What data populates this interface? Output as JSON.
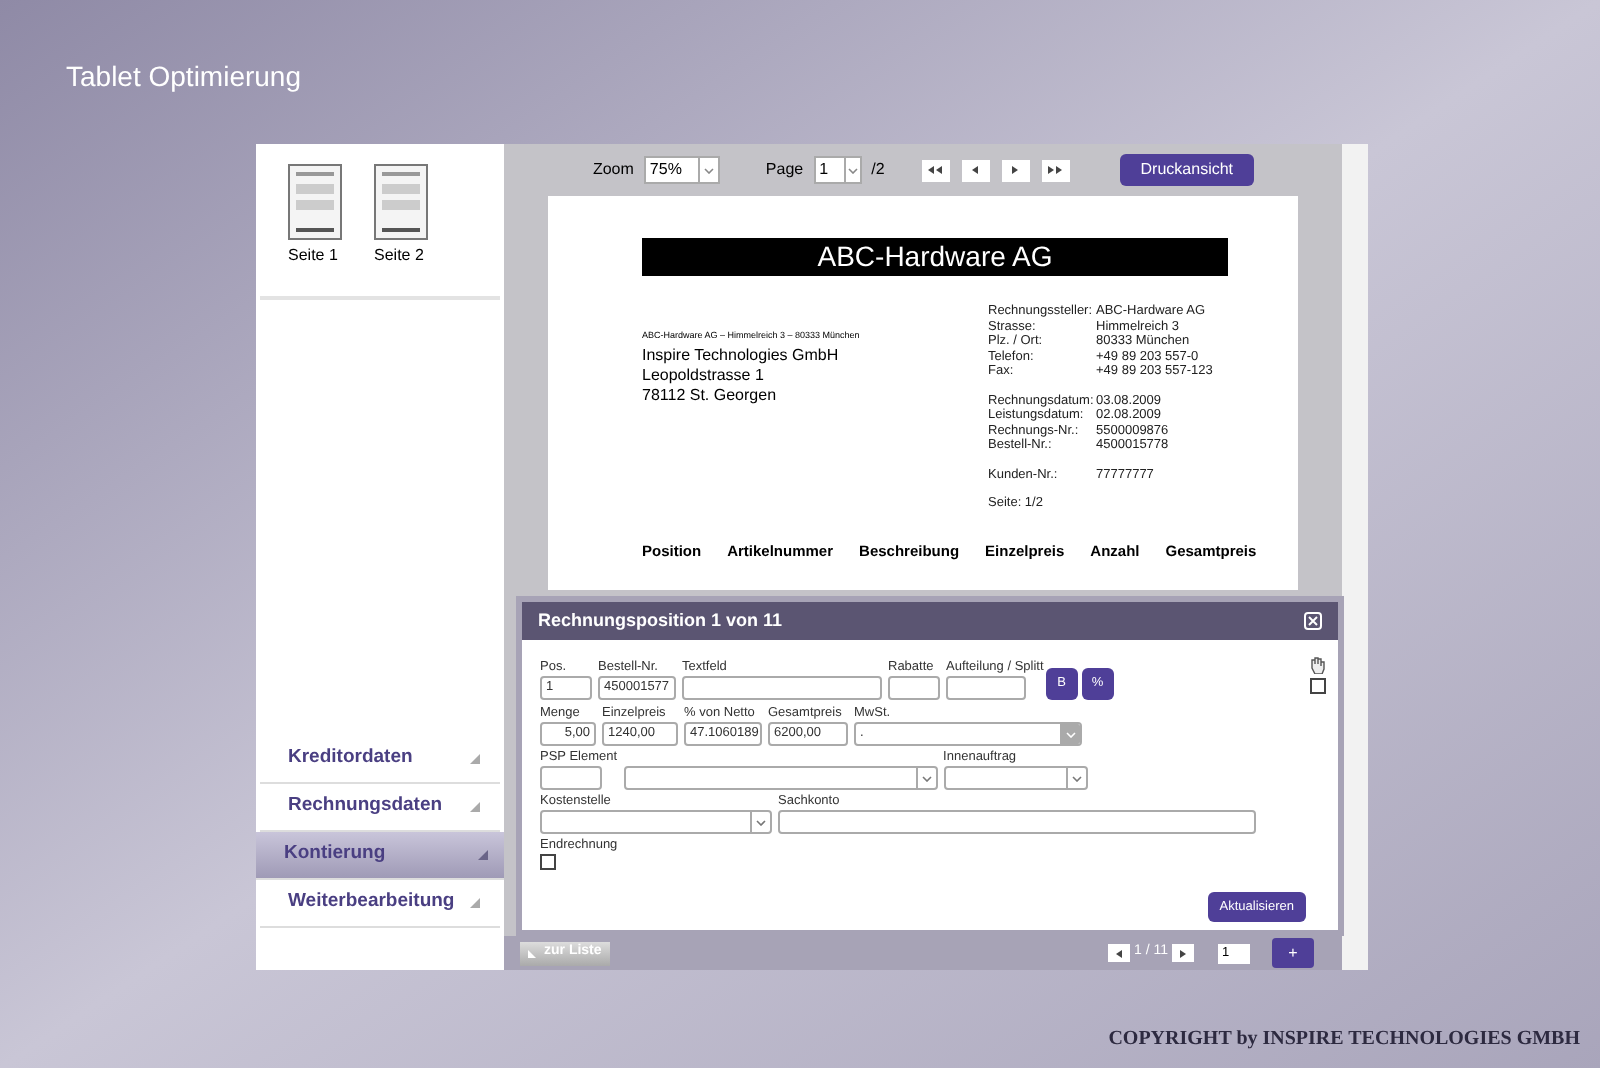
{
  "slide_title": "Tablet Optimierung",
  "thumbnails": [
    {
      "label": "Seite 1",
      "selected": false
    },
    {
      "label": "Seite 2",
      "selected": false
    }
  ],
  "nav": [
    {
      "label": "Kreditordaten",
      "selected": false
    },
    {
      "label": "Rechnungsdaten",
      "selected": false
    },
    {
      "label": "Kontierung",
      "selected": true
    },
    {
      "label": "Weiterbearbeitung",
      "selected": false
    }
  ],
  "toolbar": {
    "zoom_label": "Zoom",
    "zoom_value": "75%",
    "page_label": "Page",
    "page_value": "1",
    "page_total": "/2",
    "print_button": "Druckansicht"
  },
  "document": {
    "company": "ABC-Hardware AG",
    "sender_line": "ABC-Hardware AG – Himmelreich 3 – 80333 München",
    "address": [
      "Inspire Technologies GmbH",
      "Leopoldstrasse 1",
      "78112 St. Georgen"
    ],
    "info_groups": [
      [
        [
          "Rechnungssteller:",
          "ABC-Hardware AG"
        ],
        [
          "Strasse:",
          "Himmelreich 3"
        ],
        [
          "Plz. / Ort:",
          "80333 München"
        ],
        [
          "Telefon:",
          "+49 89 203 557-0"
        ],
        [
          "Fax:",
          "+49 89 203 557-123"
        ]
      ],
      [
        [
          "Rechnungsdatum:",
          "03.08.2009"
        ],
        [
          "Leistungsdatum:",
          "02.08.2009"
        ],
        [
          "Rechnungs-Nr.:",
          "5500009876"
        ],
        [
          "Bestell-Nr.:",
          "4500015778"
        ]
      ],
      [
        [
          "Kunden-Nr.:",
          "77777777"
        ]
      ],
      [
        [
          "Seite: 1/2"
        ]
      ]
    ],
    "table_headers": [
      "Position",
      "Artikelnummer",
      "Beschreibung",
      "Einzelpreis",
      "Anzahl",
      "Gesamtpreis"
    ]
  },
  "dialog": {
    "title": "Rechnungsposition 1 von 11",
    "pos": {
      "label": "Pos.",
      "value": "1"
    },
    "bestell": {
      "label": "Bestell-Nr.",
      "value": "450001577"
    },
    "textfeld": {
      "label": "Textfeld"
    },
    "rabatte": {
      "label": "Rabatte"
    },
    "split": {
      "label": "Aufteilung / Splitt"
    },
    "split_buttons": [
      "B",
      "%"
    ],
    "menge": {
      "label": "Menge",
      "value": "5,00"
    },
    "einzelpreis": {
      "label": "Einzelpreis",
      "value": "1240,00"
    },
    "netto": {
      "label": "% von Netto",
      "value": "47.1060189"
    },
    "gesamtpreis": {
      "label": "Gesamtpreis",
      "value": "6200,00"
    },
    "mwst": {
      "label": "MwSt.",
      "value": "."
    },
    "psp": {
      "label": "PSP Element"
    },
    "innenauftrag": {
      "label": "Innenauftrag"
    },
    "kostenstelle": {
      "label": "Kostenstelle"
    },
    "sachkonto": {
      "label": "Sachkonto"
    },
    "endrechnung": {
      "label": "Endrechnung",
      "checked": false
    },
    "side_checkbox": {
      "checked": false
    },
    "update_button": "Aktualisieren"
  },
  "footer": {
    "back_button": "zur Liste",
    "pager": "1 / 11",
    "page_input": "1",
    "add_button": "+"
  },
  "copyright": "COPYRIGHT by INSPIRE TECHNOLOGIES GMBH"
}
